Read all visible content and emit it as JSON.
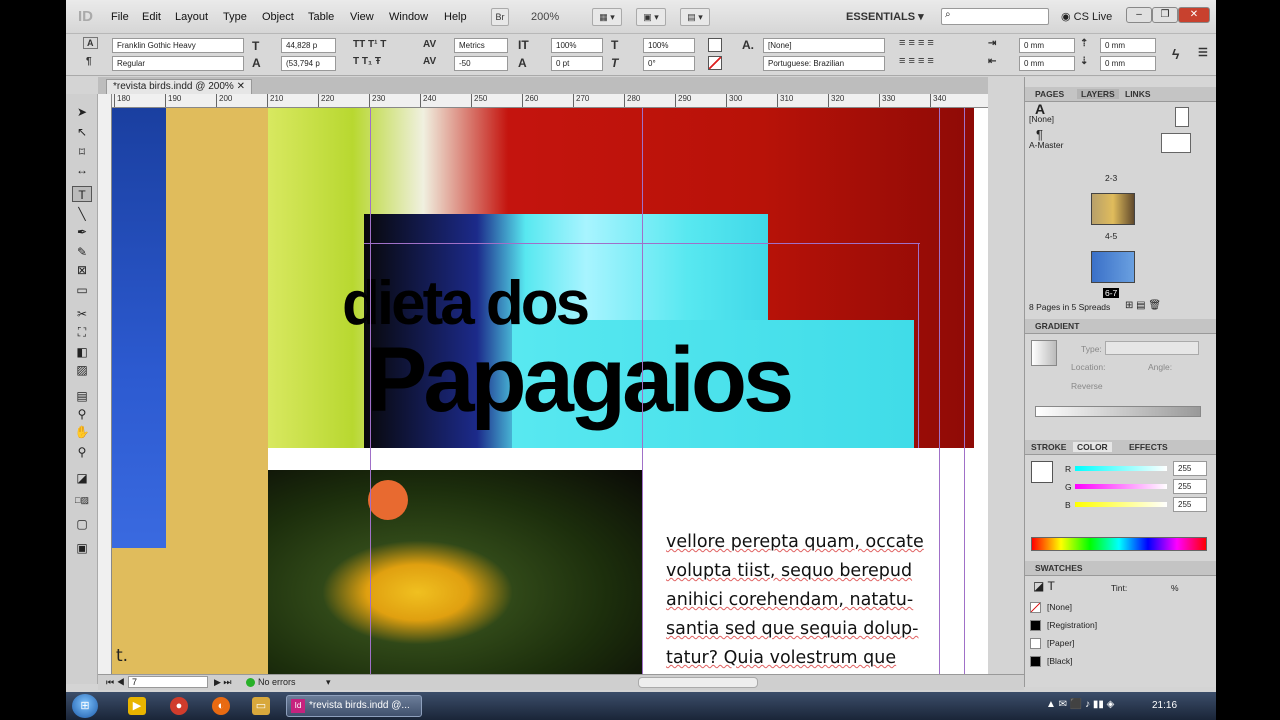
{
  "app": {
    "logo": "ID",
    "menus": [
      "File",
      "Edit",
      "Layout",
      "Type",
      "Object",
      "Table",
      "View",
      "Window",
      "Help"
    ],
    "bridge_label": "Br",
    "zoom": "200%",
    "workspace": "ESSENTIALS",
    "cs_live": "CS Live"
  },
  "control": {
    "font_family": "Franklin Gothic Heavy",
    "font_style": "Regular",
    "font_size": "44,828 p",
    "leading": "(53,794 p",
    "kerning": "Metrics",
    "tracking": "-50",
    "v_scale": "100%",
    "h_scale": "100%",
    "baseline": "0 pt",
    "skew": "0°",
    "char_style": "[None]",
    "language": "Portuguese: Brazilian",
    "indent_left": "0 mm",
    "indent_right": "0 mm",
    "space_before": "0 mm",
    "space_after": "0 mm"
  },
  "document": {
    "tab_title": "*revista birds.indd @ 200%",
    "ruler_ticks": [
      "180",
      "190",
      "200",
      "210",
      "220",
      "230",
      "240",
      "250",
      "260",
      "270",
      "280",
      "290",
      "300",
      "310",
      "320",
      "330",
      "340"
    ],
    "heading_line1": "dieta dos",
    "heading_line2": "Papagaios",
    "body_lines": [
      "vellore perepta quam, occate",
      "volupta tiist, sequo berepud",
      "anihici corehendam, natatu-",
      "santia sed que sequia dolup-",
      "tatur? Quia volestrum que"
    ],
    "side_letter": "t."
  },
  "pages_panel": {
    "tabs": [
      "PAGES",
      "LAYERS",
      "LINKS"
    ],
    "masters": [
      "[None]",
      "A-Master"
    ],
    "spread_labels": [
      "2-3",
      "4-5",
      "6-7"
    ],
    "summary": "8 Pages in 5 Spreads"
  },
  "gradient_panel": {
    "title": "GRADIENT",
    "type_label": "Type:",
    "location_label": "Location:",
    "angle_label": "Angle:",
    "reverse_label": "Reverse"
  },
  "color_panel": {
    "tabs": [
      "STROKE",
      "COLOR",
      "EFFECTS"
    ],
    "channels": [
      {
        "label": "R",
        "value": "255"
      },
      {
        "label": "G",
        "value": "255"
      },
      {
        "label": "B",
        "value": "255"
      }
    ]
  },
  "swatches_panel": {
    "title": "SWATCHES",
    "tint_label": "Tint:",
    "percent": "%",
    "swatches": [
      {
        "name": "[None]",
        "color": "#ffffff"
      },
      {
        "name": "[Registration]",
        "color": "#000000"
      },
      {
        "name": "[Paper]",
        "color": "#ffffff"
      },
      {
        "name": "[Black]",
        "color": "#000000"
      }
    ]
  },
  "status": {
    "page": "7",
    "preflight": "No errors"
  },
  "taskbar": {
    "task_label": "*revista birds.indd @...",
    "clock": "21:16"
  },
  "colors": {
    "gold": "#e0bc5c",
    "red": "#c4140e",
    "cyan": "#58e8f0",
    "blue": "#2a48b8",
    "guide": "#a070c8"
  }
}
